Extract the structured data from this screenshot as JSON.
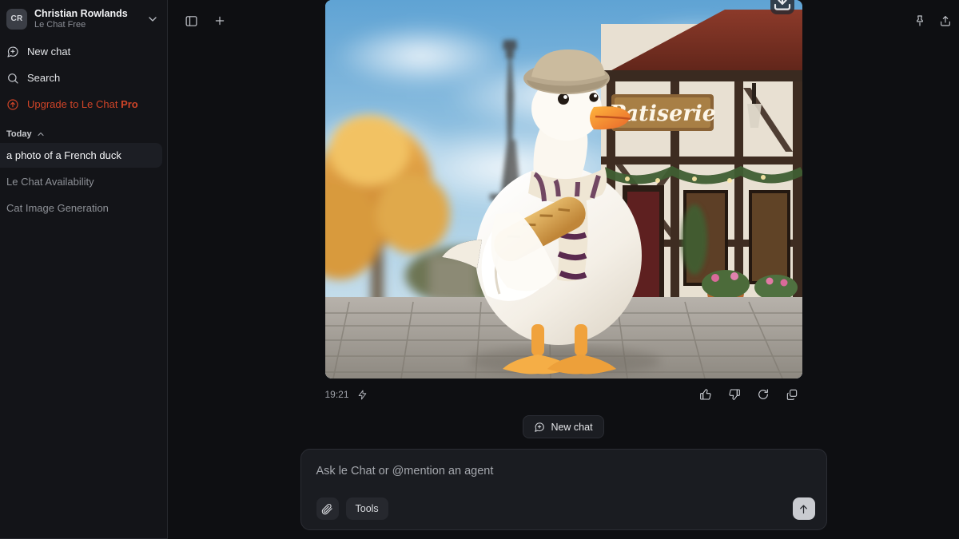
{
  "sidebar": {
    "account": {
      "initials": "CR",
      "name": "Christian Rowlands",
      "plan": "Le Chat Free"
    },
    "nav": [
      {
        "label": "New chat",
        "icon": "new-chat-icon"
      },
      {
        "label": "Search",
        "icon": "search-icon"
      }
    ],
    "upgrade": {
      "label": "Upgrade to Le Chat ",
      "emphasis": "Pro",
      "color": "#cf4428"
    },
    "section": {
      "label": "Today"
    },
    "chats": [
      {
        "label": "a photo of a French duck",
        "active": true
      },
      {
        "label": "Le Chat Availability",
        "active": false
      },
      {
        "label": "Cat Image Generation",
        "active": false
      }
    ]
  },
  "topbar": {
    "toggle_sidebar": "sidebar-toggle-icon",
    "new_chat": "plus-icon",
    "pin": "pin-icon",
    "share": "share-icon"
  },
  "message": {
    "image_alt": "a photo of a French duck wearing a beret and scarf holding a baguette in front of the Eiffel Tower and a Patiserie shop",
    "image_sign_text": "Patiserie",
    "download_label": "download-image",
    "timestamp": "19:21",
    "model_icon": "lightning-bolt-icon",
    "actions": [
      {
        "name": "thumbs-up",
        "label": "Good response"
      },
      {
        "name": "thumbs-down",
        "label": "Bad response"
      },
      {
        "name": "regenerate",
        "label": "Regenerate"
      },
      {
        "name": "copy",
        "label": "Copy"
      }
    ]
  },
  "new_chat_pill": {
    "label": "New chat"
  },
  "composer": {
    "placeholder": "Ask le Chat or @mention an agent",
    "attach_label": "attach-file",
    "tools_label": "Tools",
    "send_label": "send-message"
  }
}
